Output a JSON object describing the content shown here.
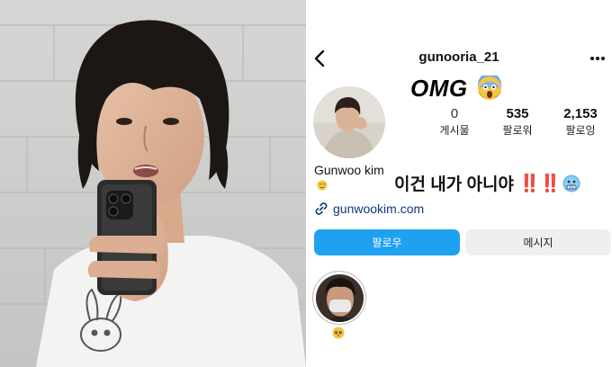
{
  "profile": {
    "username": "gunooria_21",
    "headline": "OMG",
    "stats": [
      {
        "value": "0",
        "label": "게시물"
      },
      {
        "value": "535",
        "label": "팔로워"
      },
      {
        "value": "2,153",
        "label": "팔로잉"
      }
    ],
    "display_name": "Gunwoo kim",
    "bio": "이건 내가 아니야",
    "bio_marks": "‼️‼️",
    "link": "gunwookim.com",
    "follow_label": "팔로우",
    "message_label": "메시지"
  },
  "icons": {
    "back": "chevron-left-icon",
    "more": "more-dots-icon",
    "headline_emoji": "screaming-face-emoji",
    "bio_emoji": "cold-face-emoji",
    "name_emoji": "blushing-face-emoji",
    "link": "link-icon",
    "highlight_emoji": "pleading-face-emoji"
  },
  "colors": {
    "follow_button": "#1ea1f1",
    "message_button": "#efefef",
    "link_text": "#0d3a7a",
    "exclamation": "#d91e18"
  }
}
